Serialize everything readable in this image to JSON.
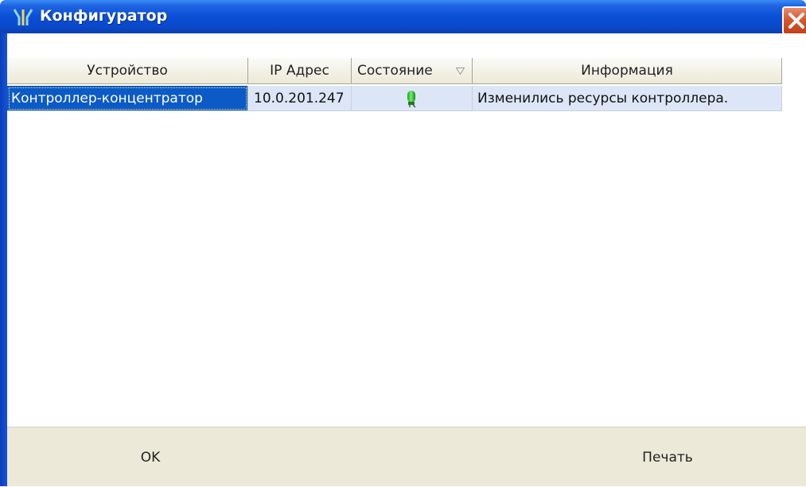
{
  "window": {
    "title": "Конфигуратор"
  },
  "grid": {
    "columns": [
      {
        "key": "device",
        "label": "Устройство"
      },
      {
        "key": "ip",
        "label": "IP Адрес"
      },
      {
        "key": "state",
        "label": "Состояние"
      },
      {
        "key": "info",
        "label": "Информация"
      }
    ],
    "rows": [
      {
        "device": "Контроллер-концентратор",
        "ip": "10.0.201.247",
        "state_icon": "green-status-indicator-icon",
        "info": "Изменились ресурсы контроллера."
      }
    ]
  },
  "buttons": {
    "ok_label": "OK",
    "print_label": "Печать"
  },
  "colors": {
    "titlebar": "#0a4fd6",
    "selection": "#0b5ac8",
    "row_bg": "#dce6f7",
    "panel": "#ece9d8",
    "status_ok": "#2ecc40"
  }
}
